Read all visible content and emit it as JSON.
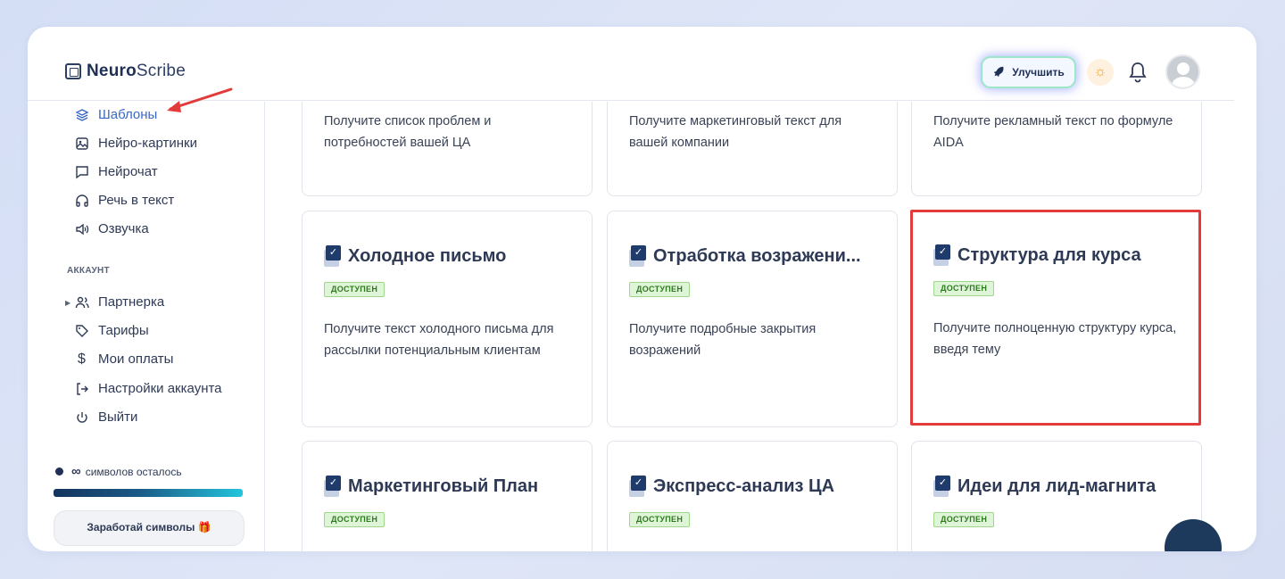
{
  "header": {
    "logo_bold": "Neuro",
    "logo_regular": "Scribe",
    "upgrade_label": "Улучшить"
  },
  "sidebar": {
    "items": [
      {
        "label": "Шаблоны",
        "icon": "layers-icon",
        "active": true
      },
      {
        "label": "Нейро-картинки",
        "icon": "image-icon"
      },
      {
        "label": "Нейрочат",
        "icon": "chat-icon"
      },
      {
        "label": "Речь в текст",
        "icon": "headphones-icon"
      },
      {
        "label": "Озвучка",
        "icon": "speaker-icon"
      }
    ],
    "account_label": "АККАУНТ",
    "account_items": [
      {
        "label": "Партнерка",
        "icon": "users-icon"
      },
      {
        "label": "Тарифы",
        "icon": "tag-icon"
      },
      {
        "label": "Мои оплаты",
        "icon": "dollar-icon"
      },
      {
        "label": "Настройки аккаунта",
        "icon": "logout-icon"
      },
      {
        "label": "Выйти",
        "icon": "power-icon"
      }
    ],
    "symbols_value": "∞",
    "symbols_label": "символов осталось",
    "symbols_progress": 1.0,
    "earn_label": "Заработай символы 🎁"
  },
  "cards": {
    "row1": [
      {
        "desc": "Получите список проблем и потребностей вашей ЦА"
      },
      {
        "desc": "Получите маркетинговый текст для вашей компании"
      },
      {
        "desc": "Получите рекламный текст по формуле AIDA"
      }
    ],
    "row2": [
      {
        "title": "Холодное письмо",
        "badge": "ДОСТУПЕН",
        "desc": "Получите текст холодного письма для рассылки потенциальным клиентам"
      },
      {
        "title": "Отработка возражени...",
        "badge": "ДОСТУПЕН",
        "desc": "Получите подробные закрытия возражений"
      },
      {
        "title": "Структура для курса",
        "badge": "ДОСТУПЕН",
        "desc": "Получите полноценную структуру курса, введя тему"
      }
    ],
    "row3": [
      {
        "title": "Маркетинговый План",
        "badge": "ДОСТУПЕН"
      },
      {
        "title": "Экспресс-анализ ЦА",
        "badge": "ДОСТУПЕН"
      },
      {
        "title": "Идеи для лид-магнита",
        "badge": "ДОСТУПЕН"
      }
    ]
  },
  "colors": {
    "accent": "#3a68c9",
    "highlight": "#e33b3b",
    "badge_bg": "#dff5d8",
    "navy": "#1f3056"
  }
}
